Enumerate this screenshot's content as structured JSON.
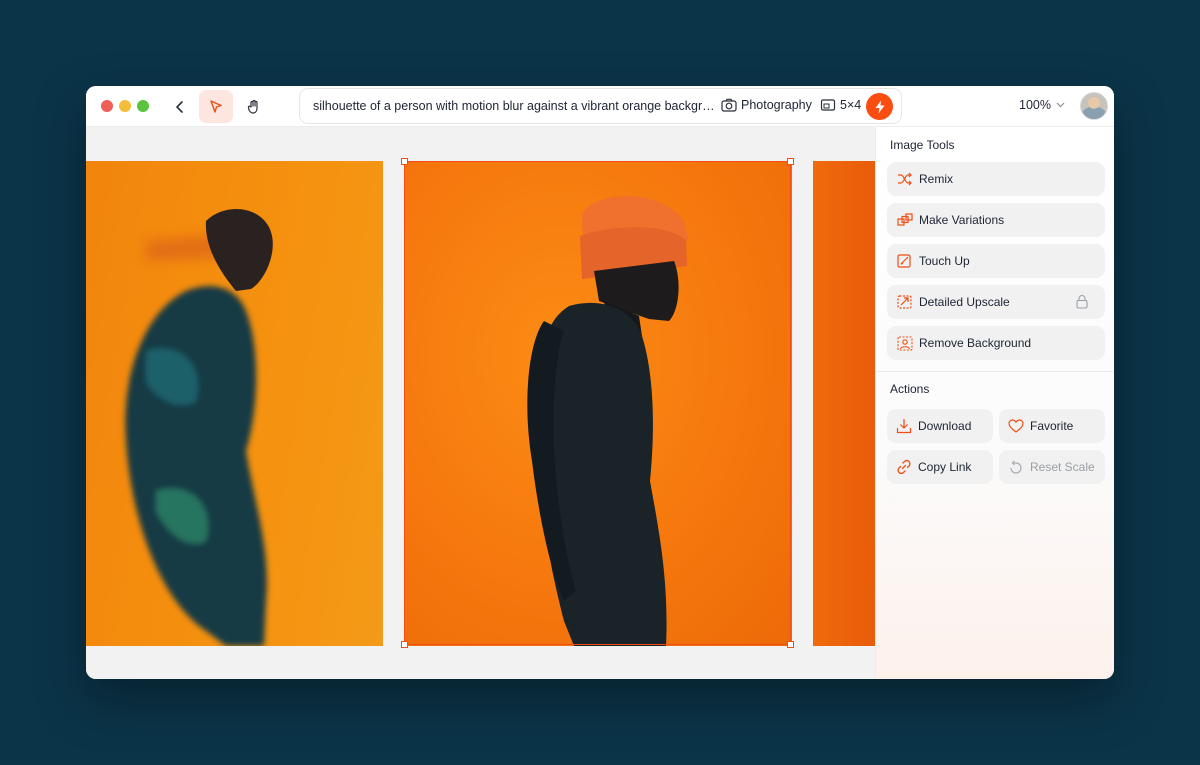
{
  "toolbar": {
    "prompt": "silhouette of a person with motion blur against a vibrant orange background, m…",
    "style_label": "Photography",
    "ratio_label": "5×4",
    "zoom_label": "100%"
  },
  "panel": {
    "image_tools_heading": "Image Tools",
    "tools": [
      {
        "label": "Remix",
        "icon": "shuffle-icon"
      },
      {
        "label": "Make Variations",
        "icon": "variations-icon"
      },
      {
        "label": "Touch Up",
        "icon": "touch-up-icon"
      },
      {
        "label": "Detailed Upscale",
        "icon": "upscale-icon",
        "locked": true
      },
      {
        "label": "Remove Background",
        "icon": "remove-background-icon"
      }
    ],
    "actions_heading": "Actions",
    "actions": [
      {
        "label": "Download",
        "icon": "download-icon"
      },
      {
        "label": "Favorite",
        "icon": "heart-icon"
      },
      {
        "label": "Copy Link",
        "icon": "link-icon"
      },
      {
        "label": "Reset Scale",
        "icon": "reset-icon",
        "disabled": true
      }
    ]
  },
  "colors": {
    "accent": "#fa4d12",
    "background": "#0b3448",
    "canvas": "#f2f2f2",
    "image_orange": "#f5760d"
  }
}
